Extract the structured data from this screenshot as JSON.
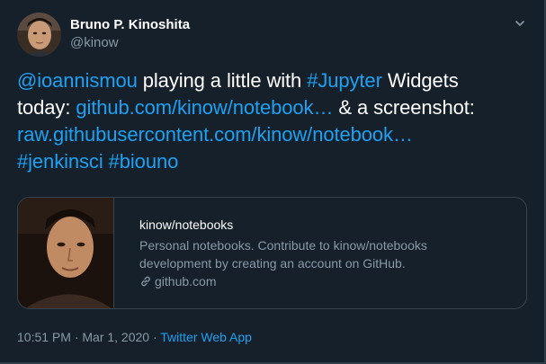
{
  "user": {
    "name": "Bruno P. Kinoshita",
    "handle": "@kinow"
  },
  "tweet": {
    "line1": {
      "mention": "@ioannismou",
      "text_a": " playing a little with ",
      "hashtag": "#Jupyter",
      "text_b": " Widgets"
    },
    "line2": {
      "text_a": "today: ",
      "link": "github.com/kinow/notebook…",
      "text_b": " & a screenshot:"
    },
    "line3": {
      "link": "raw.githubusercontent.com/kinow/notebook…"
    },
    "line4": {
      "hashtag1": "#jenkinsci",
      "space": " ",
      "hashtag2": "#biouno"
    }
  },
  "card": {
    "title": "kinow/notebooks",
    "description_line1": "Personal notebooks. Contribute to kinow/notebooks",
    "description_line2": "development by creating an account on GitHub.",
    "domain": "github.com"
  },
  "meta": {
    "timestamp": "10:51 PM · Mar 1, 2020 · ",
    "source": "Twitter Web App"
  },
  "icons": {
    "caret": "chevron-down-icon",
    "link": "link-icon"
  },
  "colors": {
    "background": "#15202b",
    "link": "#1da1f2",
    "secondary_text": "#8899a6",
    "border": "#38444d"
  }
}
